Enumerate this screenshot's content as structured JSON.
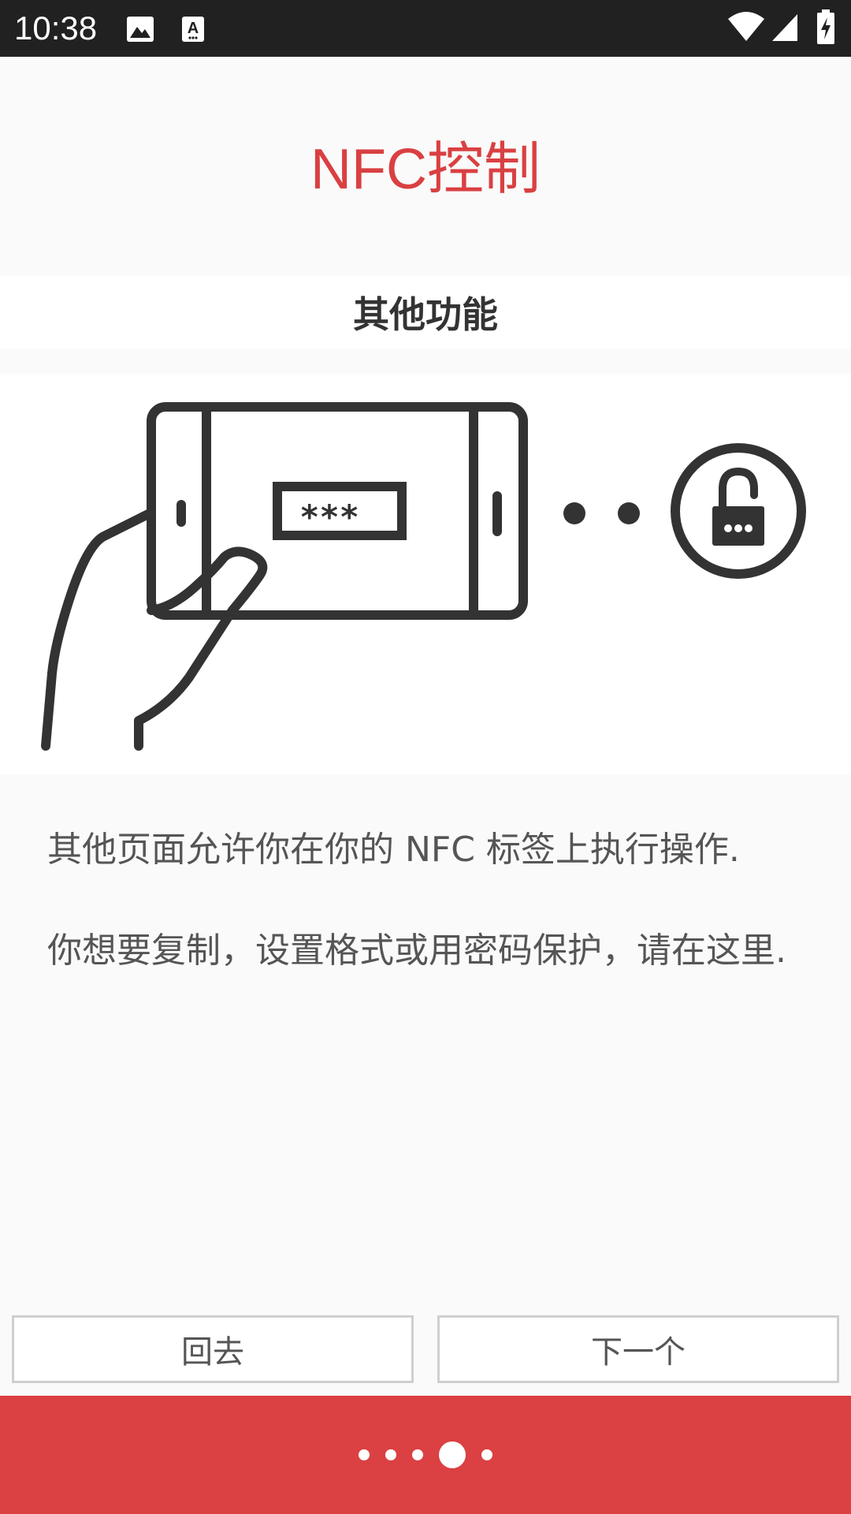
{
  "status_bar": {
    "time": "10:38",
    "icons": [
      "image-icon",
      "keyboard-a-icon",
      "wifi-icon",
      "signal-icon",
      "battery-charging-icon"
    ]
  },
  "app": {
    "title": "NFC控制"
  },
  "section": {
    "title": "其他功能"
  },
  "illustration": {
    "password_mask": "***",
    "icons": [
      "hand-holding-phone-icon",
      "lock-icon"
    ]
  },
  "description": {
    "paragraph_1": "其他页面允许你在你的 NFC 标签上执行操作.",
    "paragraph_2": "你想要复制，设置格式或用密码保护，请在这里."
  },
  "navigation": {
    "back_label": "回去",
    "next_label": "下一个"
  },
  "pager": {
    "total": 5,
    "current": 4
  },
  "colors": {
    "accent": "#db4042",
    "status_bar": "#212121",
    "line_art": "#333333"
  }
}
